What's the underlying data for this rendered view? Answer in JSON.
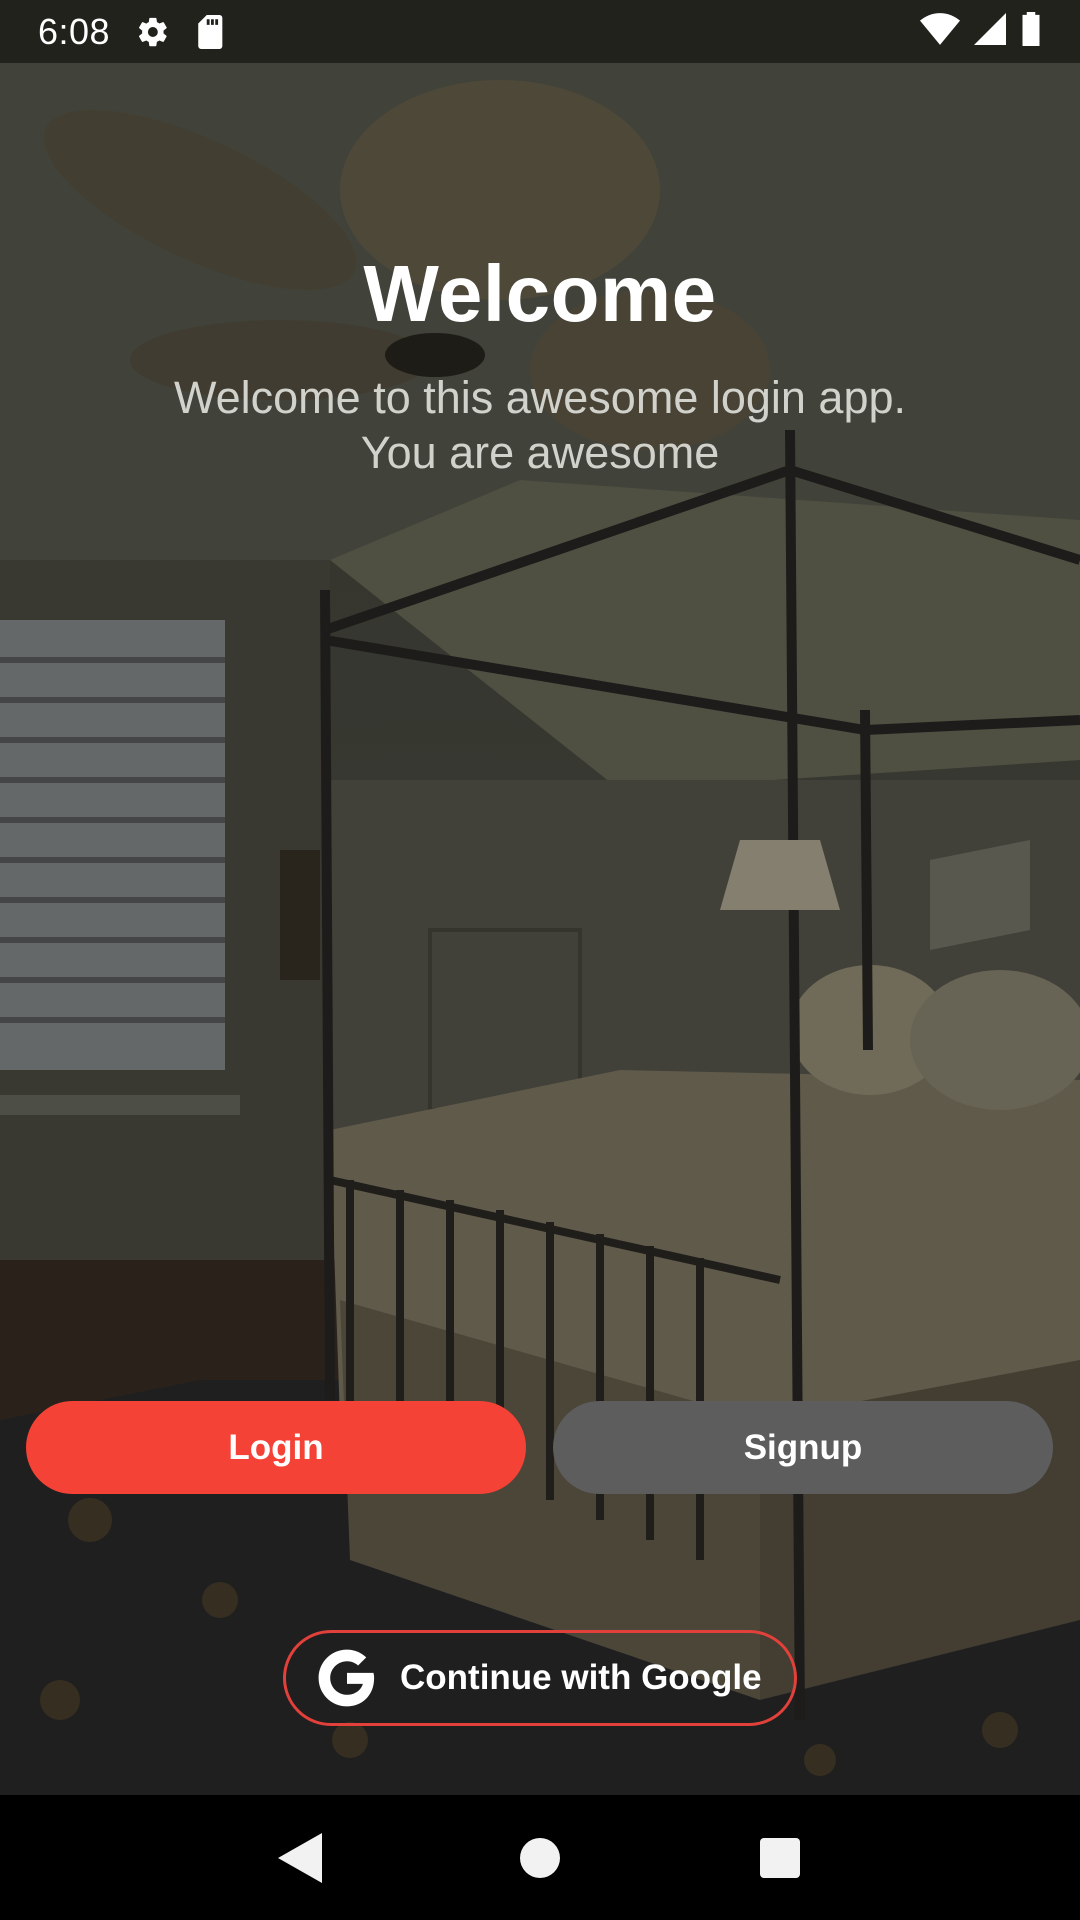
{
  "status_bar": {
    "time": "6:08",
    "icons_left": [
      "settings-icon",
      "sd-card-icon"
    ],
    "icons_right": [
      "wifi-icon",
      "cell-signal-icon",
      "battery-icon"
    ]
  },
  "welcome": {
    "title": "Welcome",
    "subtitle_line1": "Welcome to this awesome login app.",
    "subtitle_line2": "You are awesome"
  },
  "buttons": {
    "login_label": "Login",
    "signup_label": "Signup",
    "google_label": "Continue with Google",
    "google_icon": "google-g-icon"
  },
  "nav_bar": {
    "back_icon": "back-triangle-icon",
    "home_icon": "home-circle-icon",
    "recents_icon": "recents-square-icon"
  },
  "colors": {
    "login_bg": "#f44336",
    "signup_bg": "#5d5d5d",
    "google_border": "#e2403a",
    "title": "#ffffff",
    "subtitle": "#d2d2cc"
  }
}
